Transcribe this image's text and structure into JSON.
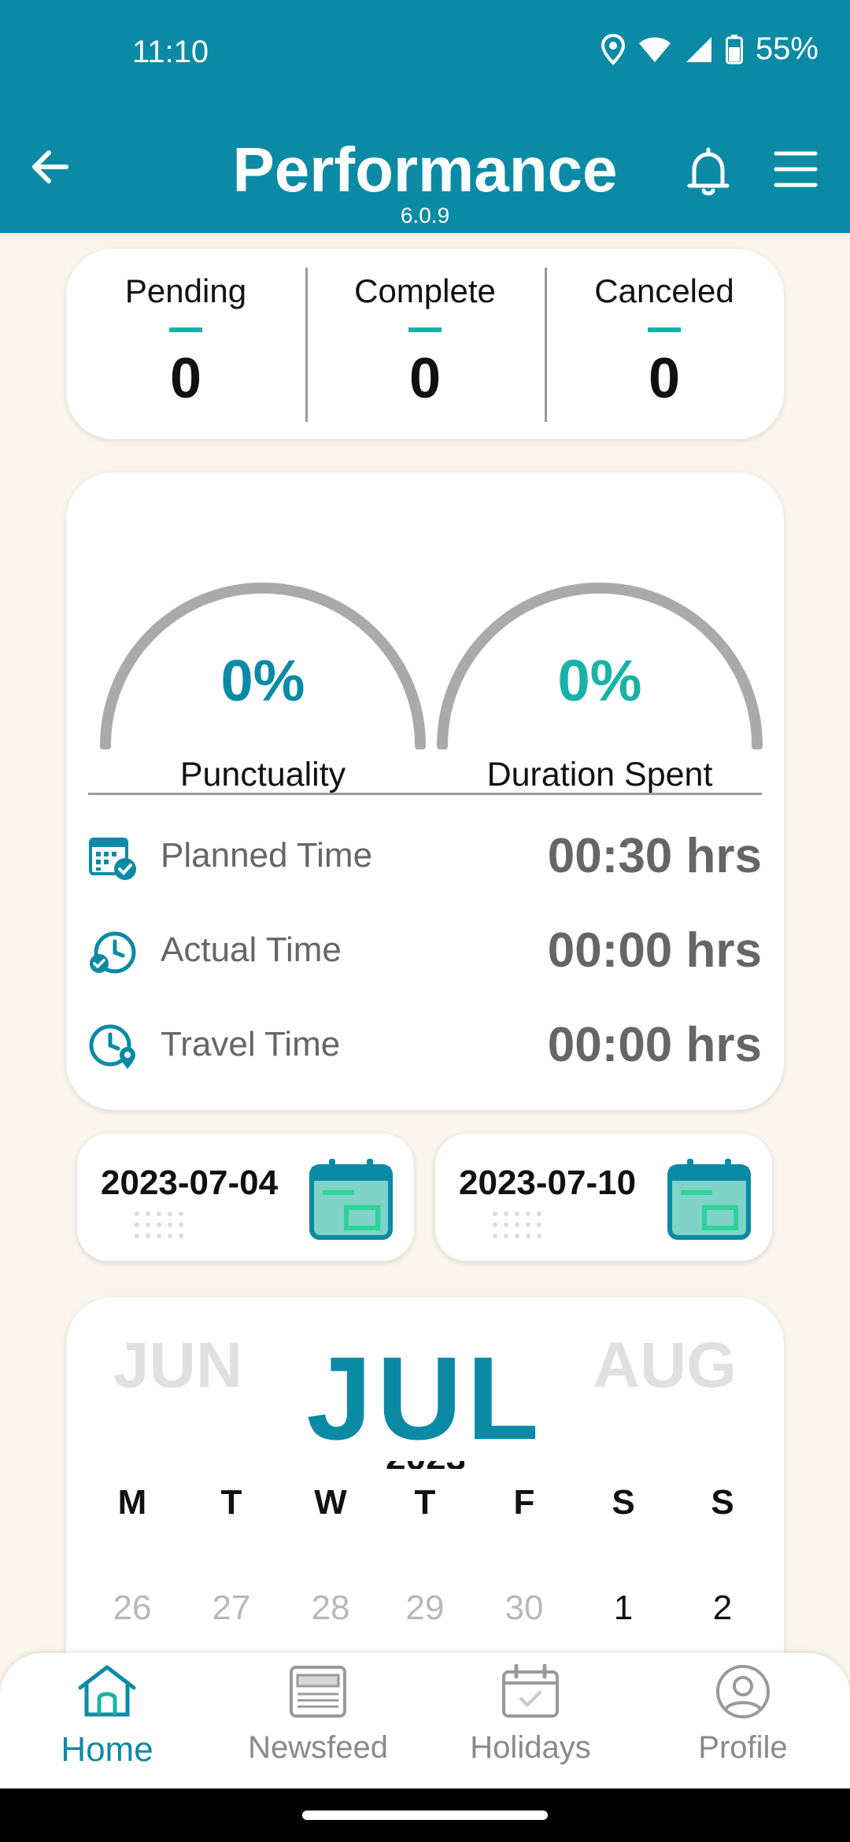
{
  "status_bar": {
    "time": "11:10",
    "battery": "55%"
  },
  "header": {
    "title": "Performance",
    "version": "6.0.9"
  },
  "counts": [
    {
      "label": "Pending",
      "value": "0"
    },
    {
      "label": "Complete",
      "value": "0"
    },
    {
      "label": "Canceled",
      "value": "0"
    }
  ],
  "gauges": [
    {
      "value": "0%",
      "label": "Punctuality",
      "color": "#0b8aa5"
    },
    {
      "value": "0%",
      "label": "Duration Spent",
      "color": "#19b3a6"
    }
  ],
  "times": [
    {
      "label": "Planned Time",
      "value": "00:30 hrs",
      "icon": "calendar-check-icon"
    },
    {
      "label": "Actual Time",
      "value": "00:00 hrs",
      "icon": "clock-check-icon"
    },
    {
      "label": "Travel Time",
      "value": "00:00 hrs",
      "icon": "clock-pin-icon"
    }
  ],
  "date_range": {
    "start": "2023-07-04",
    "end": "2023-07-10"
  },
  "calendar": {
    "prev_month": "JUN",
    "current_month": "JUL",
    "next_month": "AUG",
    "year": "2023",
    "weekdays": [
      "M",
      "T",
      "W",
      "T",
      "F",
      "S",
      "S"
    ],
    "first_week": [
      "26",
      "27",
      "28",
      "29",
      "30",
      "1",
      "2"
    ]
  },
  "bottom_nav": [
    {
      "label": "Home",
      "icon": "home-icon",
      "active": true
    },
    {
      "label": "Newsfeed",
      "icon": "newsfeed-icon",
      "active": false
    },
    {
      "label": "Holidays",
      "icon": "holidays-calendar-icon",
      "active": false
    },
    {
      "label": "Profile",
      "icon": "profile-icon",
      "active": false
    }
  ],
  "colors": {
    "primary": "#0b8aa5",
    "accent": "#19b3a6",
    "background": "#faf6ee",
    "gauge_track": "#aaaaaa"
  }
}
